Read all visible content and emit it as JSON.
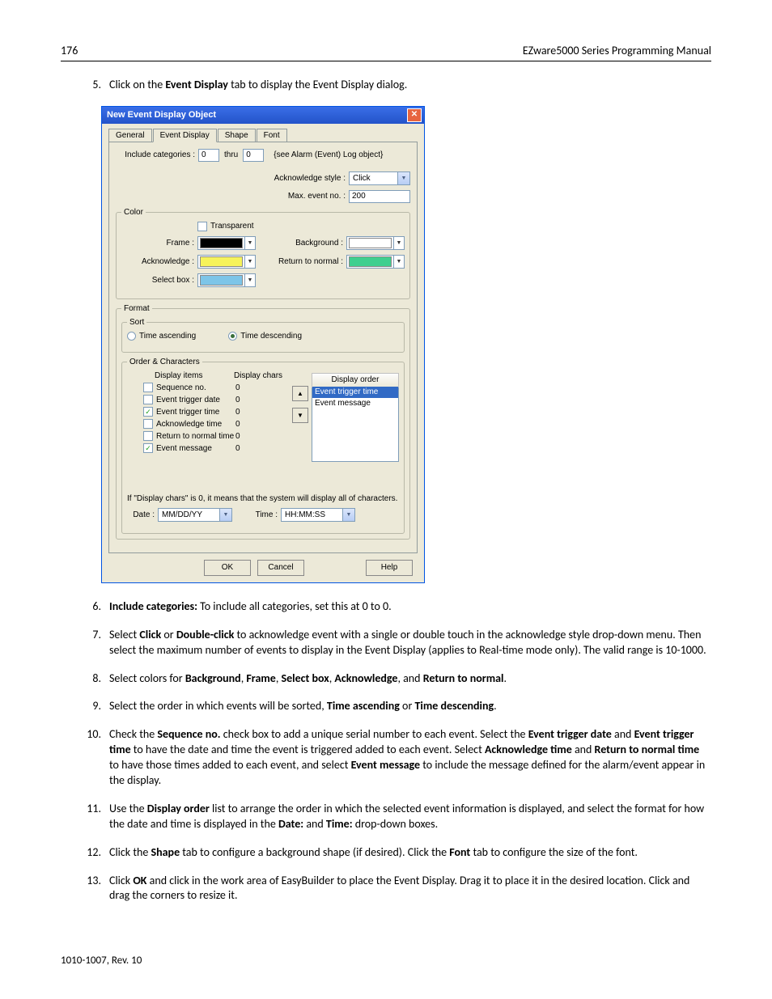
{
  "header": {
    "page_no": "176",
    "title": "EZware5000 Series Programming Manual"
  },
  "footer": {
    "text": "1010-1007, Rev. 10"
  },
  "steps": {
    "s5": {
      "num": "5.",
      "pre": "Click on the ",
      "bold": "Event Display",
      "post": " tab to display the Event Display dialog."
    },
    "s6": {
      "num": "6.",
      "bold": "Include categories:",
      "post": " To include all categories, set this at 0 to 0."
    },
    "s7": {
      "num": "7.",
      "t1": "Select ",
      "b1": "Click",
      "t2": " or ",
      "b2": "Double-click",
      "t3": " to acknowledge event with a single or double touch in the acknowledge style drop-down menu. Then select the maximum number of events to display in the Event Display (applies to Real-time mode only). The valid range is 10-1000."
    },
    "s8": {
      "num": "8.",
      "t1": "Select colors for ",
      "b1": "Background",
      "c": ", ",
      "b2": "Frame",
      "b3": "Select box",
      "b4": "Acknowledge",
      "t2": ", and ",
      "b5": "Return to normal",
      "t3": "."
    },
    "s9": {
      "num": "9.",
      "t1": "Select the order in which events will be sorted, ",
      "b1": "Time ascending",
      "t2": " or ",
      "b2": "Time descending",
      "t3": "."
    },
    "s10": {
      "num": "10.",
      "t1": "Check the ",
      "b1": "Sequence no.",
      "t2": " check box to add a unique serial number to each event. Select the ",
      "b2": "Event trigger date",
      "t3": " and ",
      "b3": "Event trigger time",
      "t4": " to have the date and time the event is triggered added to each event. Select ",
      "b4": "Acknowledge time",
      "t5": " and ",
      "b5": "Return to normal time",
      "t6": " to have those times added to each event, and select ",
      "b6": "Event message",
      "t7": " to include the message defined for the alarm/event appear in the display."
    },
    "s11": {
      "num": "11.",
      "t1": "Use the ",
      "b1": "Display order",
      "t2": " list to arrange the order in which the selected event information is displayed, and select the format for how the date and time is displayed in the ",
      "b2": "Date:",
      "t3": " and ",
      "b3": "Time:",
      "t4": " drop-down boxes."
    },
    "s12": {
      "num": "12.",
      "t1": "Click the ",
      "b1": "Shape",
      "t2": " tab to configure a background shape (if desired). Click the ",
      "b2": "Font",
      "t3": " tab to configure the size of the font."
    },
    "s13": {
      "num": "13.",
      "t1": "Click ",
      "b1": "OK",
      "t2": " and click in the work area of EasyBuilder to place the Event Display. Drag it to place it in the desired location. Click and drag the corners to resize it."
    }
  },
  "dialog": {
    "title": "New  Event Display Object",
    "tabs": [
      "General",
      "Event Display",
      "Shape",
      "Font"
    ],
    "include_cat_label": "Include categories :",
    "include_from": "0",
    "thru_label": "thru",
    "include_to": "0",
    "include_hint": "{see Alarm (Event) Log object}",
    "ack_style_label": "Acknowledge style :",
    "ack_style_value": "Click",
    "max_event_label": "Max. event no. :",
    "max_event_value": "200",
    "color_legend": "Color",
    "transparent_label": "Transparent",
    "frame_label": "Frame :",
    "background_label": "Background :",
    "acknowledge_label": "Acknowledge :",
    "return_label": "Return to normal :",
    "selectbox_label": "Select box :",
    "colors": {
      "frame": "#000000",
      "background": "#ffffff",
      "acknowledge": "#f6f35a",
      "return": "#3fcf8f",
      "selectbox": "#7dc5e8"
    },
    "format_legend": "Format",
    "sort_legend": "Sort",
    "time_asc": "Time ascending",
    "time_desc": "Time descending",
    "order_legend": "Order & Characters",
    "hdr_items": "Display items",
    "hdr_chars": "Display chars",
    "hdr_order": "Display order",
    "items": [
      {
        "name": "Sequence no.",
        "chars": "0",
        "checked": false
      },
      {
        "name": "Event trigger date",
        "chars": "0",
        "checked": false
      },
      {
        "name": "Event trigger time",
        "chars": "0",
        "checked": true
      },
      {
        "name": "Acknowledge time",
        "chars": "0",
        "checked": false
      },
      {
        "name": "Return to normal time",
        "chars": "0",
        "checked": false
      },
      {
        "name": "Event message",
        "chars": "0",
        "checked": true
      }
    ],
    "order_list": [
      "Event trigger time",
      "Event message"
    ],
    "chars_note": "If \"Display chars\" is 0, it means that the system will display all of  characters.",
    "date_label": "Date :",
    "date_value": "MM/DD/YY",
    "time_label": "Time :",
    "time_value": "HH:MM:SS",
    "ok": "OK",
    "cancel": "Cancel",
    "help": "Help"
  }
}
